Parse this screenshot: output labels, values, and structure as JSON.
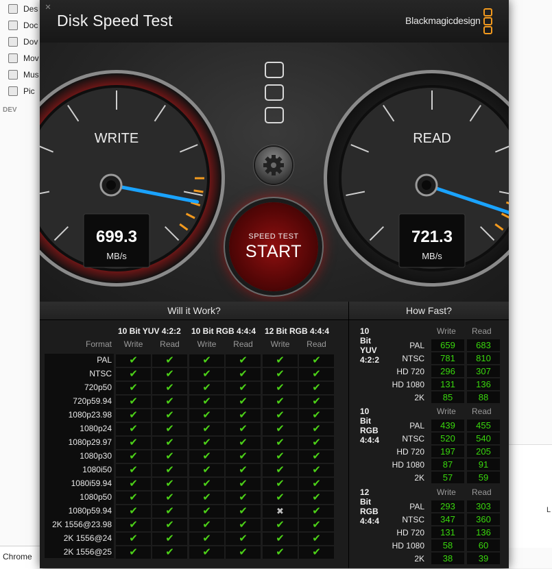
{
  "finder": {
    "sidebar_items": [
      {
        "label": "Des",
        "icon": "desktop-icon"
      },
      {
        "label": "Doc",
        "icon": "document-icon"
      },
      {
        "label": "Dov",
        "icon": "download-icon"
      },
      {
        "label": "Mov",
        "icon": "movie-icon"
      },
      {
        "label": "Mus",
        "icon": "music-icon"
      },
      {
        "label": "Pic",
        "icon": "camera-icon"
      }
    ],
    "devices_label": "DEV",
    "chrome_label": "Chrome",
    "right_letter": "L"
  },
  "app": {
    "title": "Disk Speed Test",
    "brand": "Blackmagicdesign",
    "close_glyph": "✕"
  },
  "gauges": {
    "write": {
      "label": "WRITE",
      "value": "699.3",
      "unit": "MB/s"
    },
    "read": {
      "label": "READ",
      "value": "721.3",
      "unit": "MB/s"
    }
  },
  "start_button": {
    "small": "SPEED TEST",
    "big": "START"
  },
  "will_it_work": {
    "title": "Will it Work?",
    "format_label": "Format",
    "groups": [
      "10 Bit YUV 4:2:2",
      "10 Bit RGB 4:4:4",
      "12 Bit RGB 4:4:4"
    ],
    "subcols": [
      "Write",
      "Read",
      "Write",
      "Read",
      "Write",
      "Read"
    ],
    "rows": [
      {
        "format": "PAL",
        "cells": [
          1,
          1,
          1,
          1,
          1,
          1
        ]
      },
      {
        "format": "NTSC",
        "cells": [
          1,
          1,
          1,
          1,
          1,
          1
        ]
      },
      {
        "format": "720p50",
        "cells": [
          1,
          1,
          1,
          1,
          1,
          1
        ]
      },
      {
        "format": "720p59.94",
        "cells": [
          1,
          1,
          1,
          1,
          1,
          1
        ]
      },
      {
        "format": "1080p23.98",
        "cells": [
          1,
          1,
          1,
          1,
          1,
          1
        ]
      },
      {
        "format": "1080p24",
        "cells": [
          1,
          1,
          1,
          1,
          1,
          1
        ]
      },
      {
        "format": "1080p29.97",
        "cells": [
          1,
          1,
          1,
          1,
          1,
          1
        ]
      },
      {
        "format": "1080p30",
        "cells": [
          1,
          1,
          1,
          1,
          1,
          1
        ]
      },
      {
        "format": "1080i50",
        "cells": [
          1,
          1,
          1,
          1,
          1,
          1
        ]
      },
      {
        "format": "1080i59.94",
        "cells": [
          1,
          1,
          1,
          1,
          1,
          1
        ]
      },
      {
        "format": "1080p50",
        "cells": [
          1,
          1,
          1,
          1,
          1,
          1
        ]
      },
      {
        "format": "1080p59.94",
        "cells": [
          1,
          1,
          1,
          1,
          0,
          1
        ]
      },
      {
        "format": "2K 1556@23.98",
        "cells": [
          1,
          1,
          1,
          1,
          1,
          1
        ]
      },
      {
        "format": "2K 1556@24",
        "cells": [
          1,
          1,
          1,
          1,
          1,
          1
        ]
      },
      {
        "format": "2K 1556@25",
        "cells": [
          1,
          1,
          1,
          1,
          1,
          1
        ]
      }
    ]
  },
  "how_fast": {
    "title": "How Fast?",
    "write_label": "Write",
    "read_label": "Read",
    "sections": [
      {
        "title": "10 Bit YUV 4:2:2",
        "rows": [
          {
            "label": "PAL",
            "write": "659",
            "read": "683"
          },
          {
            "label": "NTSC",
            "write": "781",
            "read": "810"
          },
          {
            "label": "HD 720",
            "write": "296",
            "read": "307"
          },
          {
            "label": "HD 1080",
            "write": "131",
            "read": "136"
          },
          {
            "label": "2K",
            "write": "85",
            "read": "88"
          }
        ]
      },
      {
        "title": "10 Bit RGB 4:4:4",
        "rows": [
          {
            "label": "PAL",
            "write": "439",
            "read": "455"
          },
          {
            "label": "NTSC",
            "write": "520",
            "read": "540"
          },
          {
            "label": "HD 720",
            "write": "197",
            "read": "205"
          },
          {
            "label": "HD 1080",
            "write": "87",
            "read": "91"
          },
          {
            "label": "2K",
            "write": "57",
            "read": "59"
          }
        ]
      },
      {
        "title": "12 Bit RGB 4:4:4",
        "rows": [
          {
            "label": "PAL",
            "write": "293",
            "read": "303"
          },
          {
            "label": "NTSC",
            "write": "347",
            "read": "360"
          },
          {
            "label": "HD 720",
            "write": "131",
            "read": "136"
          },
          {
            "label": "HD 1080",
            "write": "58",
            "read": "60"
          },
          {
            "label": "2K",
            "write": "38",
            "read": "39"
          }
        ]
      }
    ]
  },
  "colors": {
    "check": "#4cd018",
    "value": "#39d70d",
    "needle": "#1aa3ff",
    "write_ring": "#b31a1a",
    "accent": "#f39a1e"
  }
}
